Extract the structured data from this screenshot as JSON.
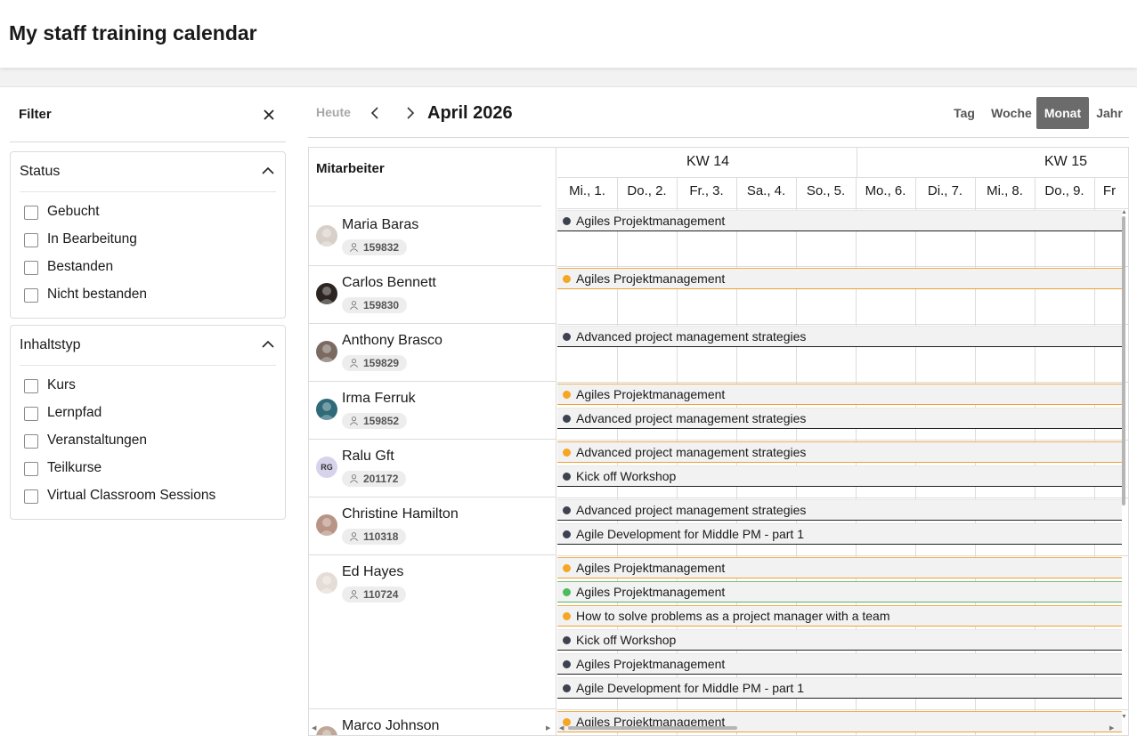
{
  "header": {
    "title": "My staff training calendar"
  },
  "filter": {
    "title": "Filter",
    "groups": [
      {
        "title": "Status",
        "options": [
          "Gebucht",
          "In Bearbeitung",
          "Bestanden",
          "Nicht bestanden"
        ]
      },
      {
        "title": "Inhaltstyp",
        "options": [
          "Kurs",
          "Lernpfad",
          "Veranstaltungen",
          "Teilkurse",
          "Virtual Classroom Sessions"
        ]
      }
    ]
  },
  "toolbar": {
    "today": "Heute",
    "month": "April 2026",
    "views": [
      "Tag",
      "Woche",
      "Monat",
      "Jahr"
    ],
    "active_view": "Monat"
  },
  "calendar": {
    "employee_header": "Mitarbeiter",
    "weeks": [
      "KW 14",
      "KW 15"
    ],
    "days": [
      "Mi., 1.",
      "Do., 2.",
      "Fr., 3.",
      "Sa., 4.",
      "So., 5.",
      "Mo., 6.",
      "Di., 7.",
      "Mi., 8.",
      "Do., 9.",
      "Fr"
    ],
    "status_colors": {
      "dark": "#3e4150",
      "orange": "#f5a623",
      "green": "#4cbb5e"
    },
    "employees": [
      {
        "name": "Maria Baras",
        "id": "159832",
        "avatar": "photo",
        "avatar_color": "#d8d0c8",
        "events": [
          {
            "title": "Agiles Projektmanagement",
            "status": "dark"
          }
        ]
      },
      {
        "name": "Carlos Bennett",
        "id": "159830",
        "avatar": "photo",
        "avatar_color": "#2c2420",
        "events": [
          {
            "title": "Agiles Projektmanagement",
            "status": "orange"
          }
        ]
      },
      {
        "name": "Anthony Brasco",
        "id": "159829",
        "avatar": "photo",
        "avatar_color": "#7a6a62",
        "events": [
          {
            "title": "Advanced project management strategies",
            "status": "dark"
          }
        ]
      },
      {
        "name": "Irma Ferruk",
        "id": "159852",
        "avatar": "photo",
        "avatar_color": "#2e6a78",
        "events": [
          {
            "title": "Agiles Projektmanagement",
            "status": "orange"
          },
          {
            "title": "Advanced project management strategies",
            "status": "dark"
          }
        ]
      },
      {
        "name": "Ralu Gft",
        "id": "201172",
        "avatar": "initials",
        "initials": "RG",
        "avatar_color": "#d6d3ea",
        "events": [
          {
            "title": "Advanced project management strategies",
            "status": "orange"
          },
          {
            "title": "Kick off Workshop",
            "status": "dark"
          }
        ]
      },
      {
        "name": "Christine Hamilton",
        "id": "110318",
        "avatar": "photo",
        "avatar_color": "#b89484",
        "events": [
          {
            "title": "Advanced project management strategies",
            "status": "dark"
          },
          {
            "title": "Agile Development for Middle PM - part 1",
            "status": "dark"
          }
        ]
      },
      {
        "name": "Ed Hayes",
        "id": "110724",
        "avatar": "photo",
        "avatar_color": "#e6dcd6",
        "events": [
          {
            "title": "Agiles Projektmanagement",
            "status": "orange"
          },
          {
            "title": "Agiles Projektmanagement",
            "status": "green"
          },
          {
            "title": "How to solve problems as a project manager with a team",
            "status": "orange"
          },
          {
            "title": "Kick off Workshop",
            "status": "dark"
          },
          {
            "title": "Agiles Projektmanagement",
            "status": "dark"
          },
          {
            "title": "Agile Development for Middle PM - part 1",
            "status": "dark"
          }
        ]
      },
      {
        "name": "Marco Johnson",
        "id": "",
        "avatar": "photo",
        "avatar_color": "#c0a898",
        "events": [
          {
            "title": "Agiles Projektmanagement",
            "status": "orange"
          }
        ]
      }
    ]
  }
}
